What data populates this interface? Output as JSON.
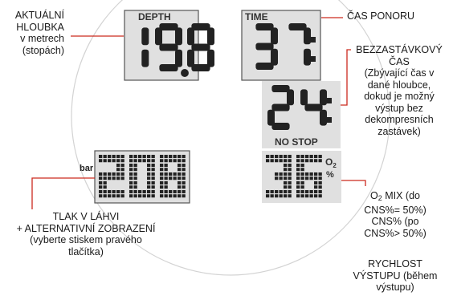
{
  "panels": {
    "depth": {
      "title": "DEPTH",
      "value": "19.8"
    },
    "time": {
      "title": "TIME",
      "value": "37"
    },
    "nostop": {
      "title": "NO STOP",
      "value": "24"
    },
    "pressure": {
      "unit": "bar",
      "value": "208"
    },
    "o2": {
      "title_o": "O",
      "title_sub": "2",
      "title_pct": "%",
      "value": "36"
    }
  },
  "labels": {
    "depth": [
      "AKTUÁLNÍ",
      "HLOUBKA",
      "v metrech",
      "(stopách)"
    ],
    "dive_time": "ČAS PONORU",
    "no_stop": [
      "BEZZASTÁVKOVÝ",
      "ČAS",
      "(Zbývající čas v",
      "dané hloubce,",
      "dokud je možný",
      "výstup bez",
      "dekompresních",
      "zastávek)"
    ],
    "pressure": [
      "TLAK V LÁHVI",
      "+ ALTERNATIVNÍ ZOBRAZENÍ",
      "(vyberte stiskem pravého",
      "tlačítka)"
    ],
    "o2_mix": {
      "pre": "O",
      "sub": "2",
      "post": " MIX (do"
    },
    "o2_lines": [
      "CNS%= 50%)",
      "CNS% (po",
      "CNS%> 50%)"
    ],
    "ascent": [
      "RYCHLOST",
      "VÝSTUPU (během",
      "výstupu)"
    ]
  },
  "colors": {
    "lcd_bg": "#e0e0e0",
    "segment": "#222222",
    "leader_line": "#cc2a1f",
    "bezel": "#cfcfcf"
  }
}
